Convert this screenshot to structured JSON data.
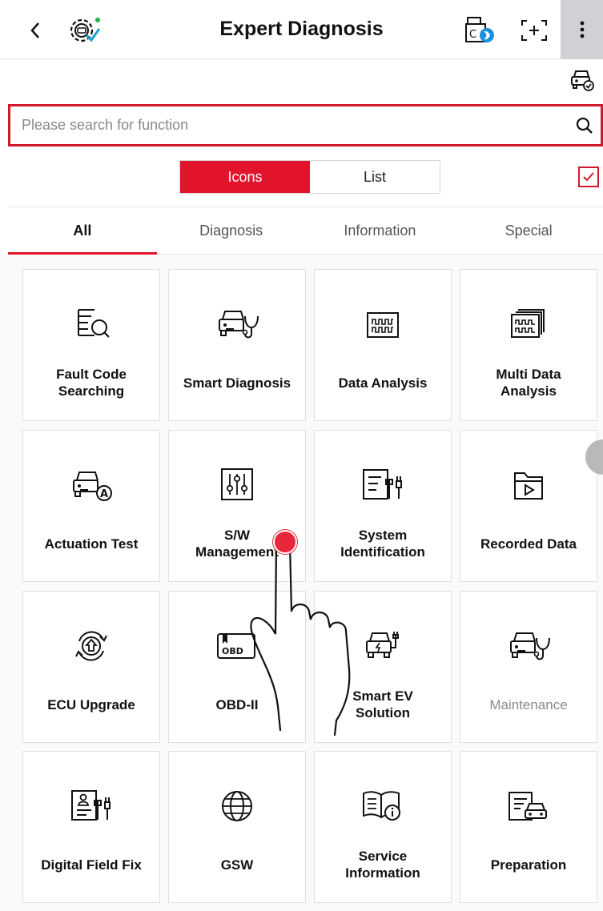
{
  "header": {
    "title": "Expert Diagnosis",
    "icons": [
      "back-icon",
      "gear-car-check-icon",
      "vci-bluetooth-icon",
      "screenshot-icon",
      "more-vertical-icon"
    ]
  },
  "subbar": {
    "icon": "car-check-icon"
  },
  "search": {
    "placeholder": "Please search for function"
  },
  "view_toggle": {
    "icons_label": "Icons",
    "list_label": "List",
    "selected": "Icons"
  },
  "checkbox": {
    "checked": true
  },
  "tabs": [
    {
      "label": "All",
      "active": true
    },
    {
      "label": "Diagnosis",
      "active": false
    },
    {
      "label": "Information",
      "active": false
    },
    {
      "label": "Special",
      "active": false
    }
  ],
  "functions": [
    {
      "line1": "Fault Code",
      "line2": "Searching",
      "icon": "fault-code-search-icon"
    },
    {
      "line1": "Smart Diagnosis",
      "line2": "",
      "icon": "car-stethoscope-icon"
    },
    {
      "line1": "Data Analysis",
      "line2": "",
      "icon": "waveform-icon"
    },
    {
      "line1": "Multi Data",
      "line2": "Analysis",
      "icon": "multi-waveform-icon"
    },
    {
      "line1": "Actuation Test",
      "line2": "",
      "icon": "car-actuation-icon"
    },
    {
      "line1": "S/W",
      "line2": "Management",
      "icon": "sliders-icon"
    },
    {
      "line1": "System",
      "line2": "Identification",
      "icon": "list-tools-icon"
    },
    {
      "line1": "Recorded Data",
      "line2": "",
      "icon": "folder-play-icon"
    },
    {
      "line1": "ECU Upgrade",
      "line2": "",
      "icon": "upgrade-cycle-icon"
    },
    {
      "line1": "OBD-II",
      "line2": "",
      "icon": "obd-icon"
    },
    {
      "line1": "Smart EV",
      "line2": "Solution",
      "icon": "ev-car-icon"
    },
    {
      "line1": "Maintenance",
      "line2": "",
      "icon": "car-stethoscope-icon",
      "dimmed": true
    },
    {
      "line1": "Digital Field Fix",
      "line2": "",
      "icon": "id-tools-icon"
    },
    {
      "line1": "GSW",
      "line2": "",
      "icon": "globe-icon"
    },
    {
      "line1": "Service",
      "line2": "Information",
      "icon": "book-info-icon"
    },
    {
      "line1": "Preparation",
      "line2": "",
      "icon": "list-car-icon"
    }
  ],
  "colors": {
    "accent": "#e1142b",
    "border": "#dfdfdf",
    "menu_bg": "#cfd1d4"
  }
}
